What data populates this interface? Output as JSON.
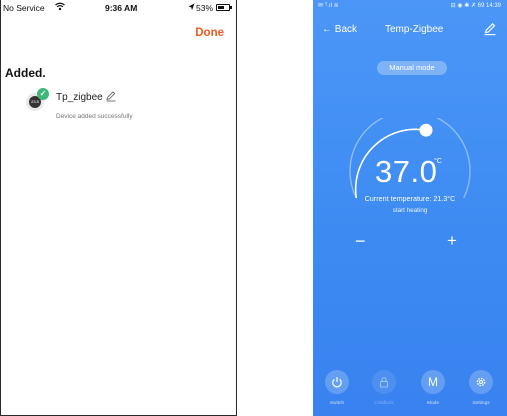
{
  "left_phone": {
    "status_bar": {
      "carrier": "No Service",
      "time": "9:36 AM",
      "battery_pct": "53%",
      "battery_level": 0.53
    },
    "done_label": "Done",
    "added_title": "Added.",
    "device": {
      "name": "Tp_zigbee",
      "status": "Device added successfully",
      "screen_text": "23.5"
    }
  },
  "right_phone": {
    "status_bar": {
      "left": "✉ ᵀ.ıl ≋",
      "right": "⊟ ◉ ✱ ✗ 69 14:39"
    },
    "back_label": "Back",
    "title": "Temp-Zigbee",
    "mode_label": "Manual mode",
    "temperature": "37.0",
    "unit": "°C",
    "current_temperature": "Current temperature: 21.3°C",
    "heating_status": "start heating",
    "minus_label": "−",
    "plus_label": "+",
    "bottom_nav": [
      {
        "label": "Switch",
        "icon": "power-icon",
        "enabled": true
      },
      {
        "label": "Childlock",
        "icon": "lock-icon",
        "enabled": false
      },
      {
        "label": "Mode",
        "icon": "mode-icon",
        "enabled": true
      },
      {
        "label": "Settings",
        "icon": "gear-icon",
        "enabled": true
      }
    ],
    "mode_glyph": "M"
  },
  "colors": {
    "accent_orange": "#ee5a24",
    "success_green": "#3cb878",
    "app_blue": "#4490f5"
  }
}
